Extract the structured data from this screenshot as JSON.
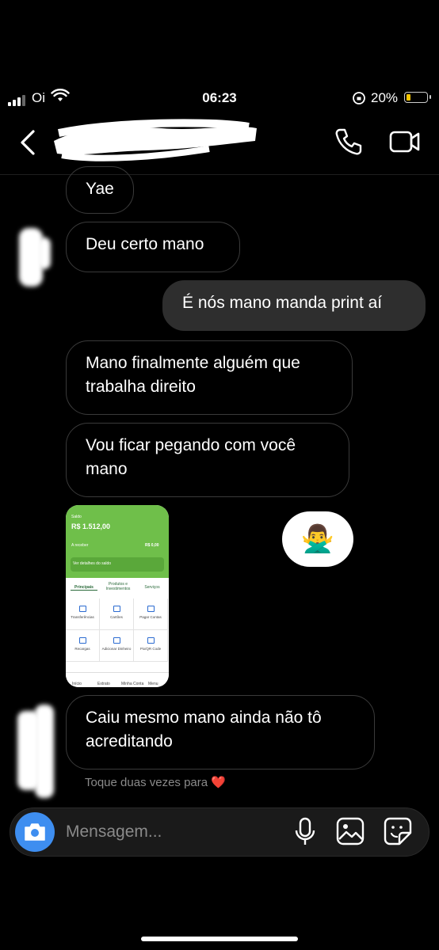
{
  "status_bar": {
    "carrier": "Oi",
    "time": "06:23",
    "battery": "20%",
    "battery_level": 0.2
  },
  "header": {
    "contact_name": ""
  },
  "messages": [
    {
      "id": "m1",
      "direction": "in",
      "text": "Yae"
    },
    {
      "id": "m2",
      "direction": "in",
      "text": "Deu certo mano"
    },
    {
      "id": "m3",
      "direction": "out",
      "text": "É nós mano manda print aí"
    },
    {
      "id": "m4",
      "direction": "in",
      "text": "Mano finalmente alguém que trabalha direito"
    },
    {
      "id": "m5",
      "direction": "in",
      "text": "Vou ficar pegando com você mano"
    },
    {
      "id": "m6",
      "direction": "in",
      "type": "image"
    },
    {
      "id": "m7",
      "direction": "in",
      "text": "Caiu mesmo mano ainda não tô acreditando"
    }
  ],
  "reaction_emoji": "🙅‍♂️",
  "shared_screenshot": {
    "saldo_label": "Saldo",
    "balance": "R$ 1.512,00",
    "receber_label": "A receber",
    "receber_value": "R$ 0,00",
    "details_link": "Ver detalhes do saldo",
    "tabs": [
      "Principais",
      "Produtos e Investimentos",
      "Serviços"
    ],
    "actions": [
      "Transferências",
      "Cartões",
      "Pagar Contas",
      "Recargas",
      "Adicionar Dinheiro",
      "Pix/QR Code"
    ],
    "nav": [
      "Início",
      "Extrato",
      "Minha Conta",
      "Menu"
    ]
  },
  "hint": {
    "text": "Toque duas vezes para",
    "heart": "❤️"
  },
  "composer": {
    "placeholder": "Mensagem..."
  },
  "icons": [
    "back-icon",
    "phone-icon",
    "video-icon",
    "camera-icon",
    "mic-icon",
    "gallery-icon",
    "sticker-icon"
  ]
}
